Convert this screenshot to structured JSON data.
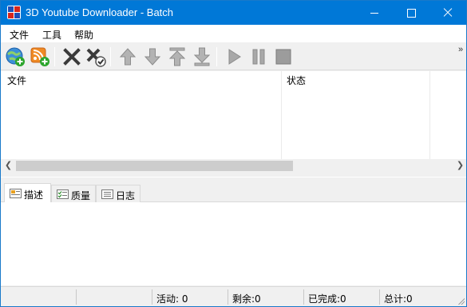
{
  "window": {
    "title": "3D Youtube Downloader - Batch",
    "accent_color": "#0078d7"
  },
  "menu": {
    "file": "文件",
    "tools": "工具",
    "help": "帮助"
  },
  "toolbar": {
    "icons": [
      "add-url-icon",
      "rss-add-icon",
      "delete-icon",
      "delete-completed-icon",
      "move-up-icon",
      "move-down-icon",
      "move-top-icon",
      "move-bottom-icon",
      "play-icon",
      "pause-icon",
      "stop-icon"
    ],
    "overflow_glyph": "»"
  },
  "list": {
    "columns": [
      "文件",
      "状态"
    ]
  },
  "tabs": [
    {
      "label": "描述",
      "active": true,
      "icon": "description-icon"
    },
    {
      "label": "质量",
      "active": false,
      "icon": "quality-icon"
    },
    {
      "label": "日志",
      "active": false,
      "icon": "log-icon"
    }
  ],
  "status": {
    "active": "活动: 0",
    "remaining": "剩余:0",
    "completed": "已完成:0",
    "total": "总计:0"
  }
}
